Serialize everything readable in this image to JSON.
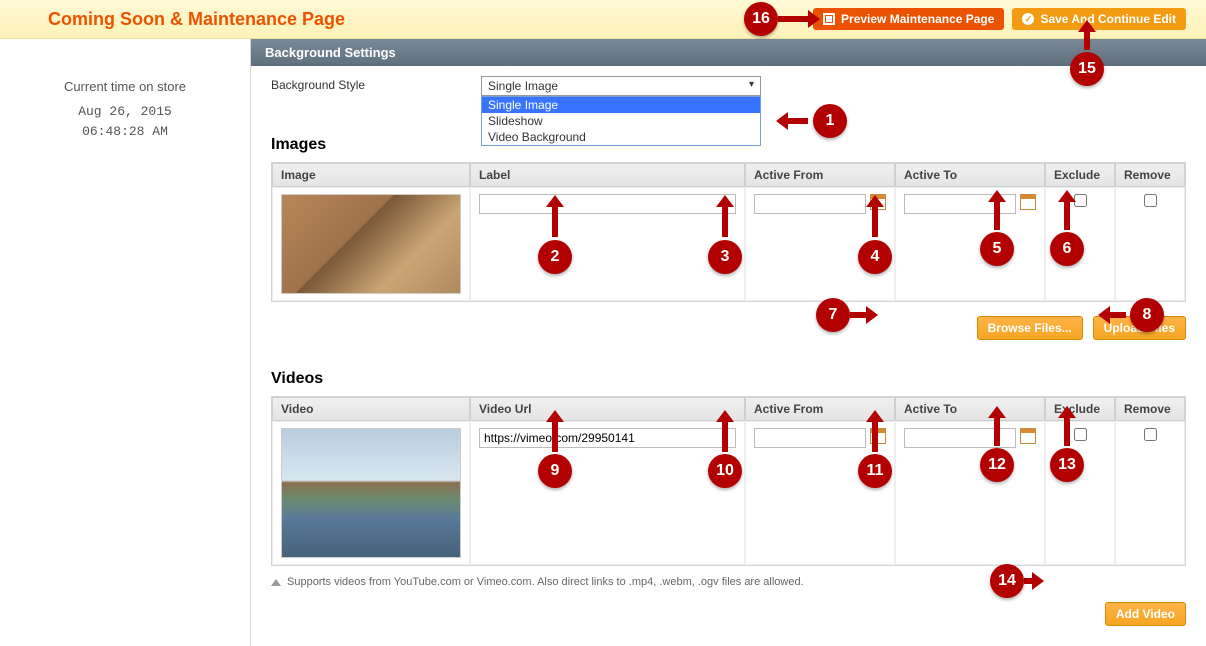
{
  "header": {
    "title": "Coming Soon & Maintenance Page",
    "preview_label": "Preview Maintenance Page",
    "save_label": "Save And Continue Edit"
  },
  "sidebar": {
    "time_label": "Current time on store",
    "date": "Aug 26, 2015",
    "time": "06:48:28 AM"
  },
  "section_header": "Background Settings",
  "bg_style": {
    "label": "Background Style",
    "selected": "Single Image",
    "options": [
      "Single Image",
      "Slideshow",
      "Video Background"
    ]
  },
  "images": {
    "title": "Images",
    "columns": [
      "Image",
      "Label",
      "Active From",
      "Active To",
      "Exclude",
      "Remove"
    ],
    "row": {
      "label": "",
      "active_from": "",
      "active_to": ""
    },
    "browse_label": "Browse Files...",
    "upload_label": "Upload Files"
  },
  "videos": {
    "title": "Videos",
    "columns": [
      "Video",
      "Video Url",
      "Active From",
      "Active To",
      "Exclude",
      "Remove"
    ],
    "row": {
      "url": "https://vimeo.com/29950141",
      "active_from": "",
      "active_to": ""
    },
    "note": "Supports videos from YouTube.com or Vimeo.com. Also direct links to .mp4, .webm, .ogv files are allowed.",
    "add_label": "Add Video"
  },
  "annotations": {
    "1": "1",
    "2": "2",
    "3": "3",
    "4": "4",
    "5": "5",
    "6": "6",
    "7": "7",
    "8": "8",
    "9": "9",
    "10": "10",
    "11": "11",
    "12": "12",
    "13": "13",
    "14": "14",
    "15": "15",
    "16": "16"
  }
}
